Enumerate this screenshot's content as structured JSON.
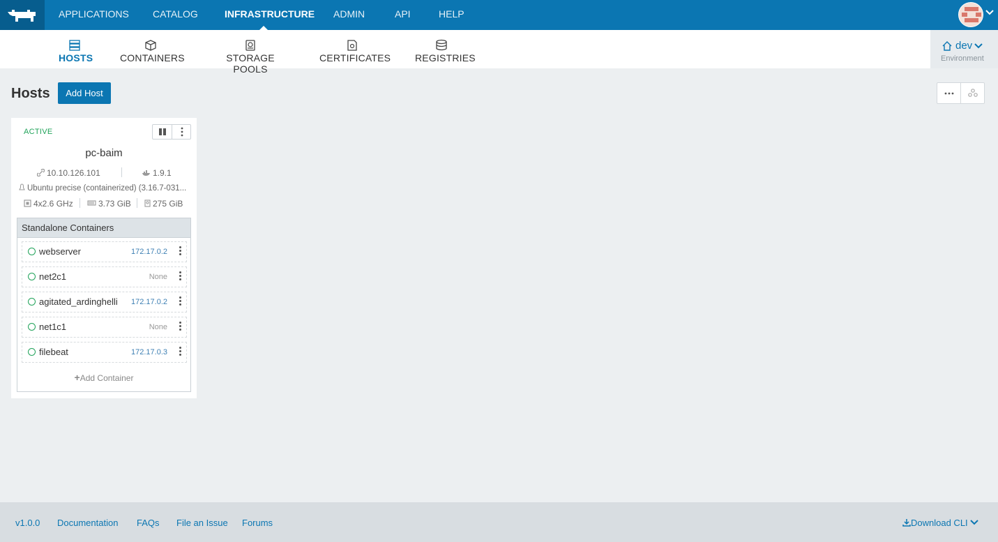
{
  "topnav": {
    "items": [
      {
        "label": "APPLICATIONS"
      },
      {
        "label": "CATALOG"
      },
      {
        "label": "INFRASTRUCTURE",
        "active": true
      },
      {
        "label": "ADMIN"
      },
      {
        "label": "API"
      },
      {
        "label": "HELP"
      }
    ],
    "brand_color": "#0b76b2",
    "logo_icon": "rancher-cow-icon",
    "avatar_icon": "user-avatar-icon"
  },
  "subnav": {
    "items": [
      {
        "label": "HOSTS",
        "icon": "hosts-icon",
        "active": true
      },
      {
        "label": "CONTAINERS",
        "icon": "container-cube-icon"
      },
      {
        "label": "STORAGE POOLS",
        "icon": "storage-drive-icon"
      },
      {
        "label": "CERTIFICATES",
        "icon": "certificate-icon"
      },
      {
        "label": "REGISTRIES",
        "icon": "database-icon"
      }
    ],
    "environment": {
      "name": "dev",
      "label": "Environment"
    }
  },
  "page": {
    "title": "Hosts",
    "add_button": "Add Host"
  },
  "host": {
    "state": "ACTIVE",
    "name": "pc-baim",
    "ip": "10.10.126.101",
    "docker_version": "1.9.1",
    "os": "Ubuntu precise (containerized) (3.16.7-031...",
    "cpu": "4x2.6 GHz",
    "memory": "3.73 GiB",
    "storage": "275 GiB",
    "containers_header": "Standalone Containers",
    "containers": [
      {
        "name": "webserver",
        "ip": "172.17.0.2"
      },
      {
        "name": "net2c1",
        "ip": "None"
      },
      {
        "name": "agitated_ardinghelli",
        "ip": "172.17.0.2"
      },
      {
        "name": "net1c1",
        "ip": "None"
      },
      {
        "name": "filebeat",
        "ip": "172.17.0.3"
      }
    ],
    "add_container": "Add Container"
  },
  "footer": {
    "version": "v1.0.0",
    "links": [
      "Documentation",
      "FAQs",
      "File an Issue",
      "Forums"
    ],
    "download": "Download CLI"
  }
}
